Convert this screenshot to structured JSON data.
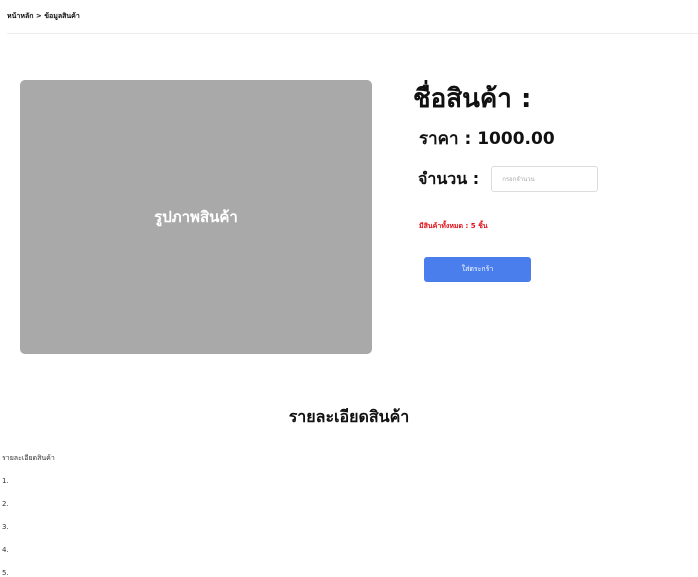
{
  "breadcrumb": {
    "text": "หน้าหลัก > ข้อมูลสินค้า"
  },
  "product": {
    "image_label": "รูปภาพสินค้า",
    "name": "ชื่อสินค้า :",
    "price_text": "ราคา : 1000.00",
    "quantity_label": "จำนวน :",
    "quantity_placeholder": "กรอกจำนวน",
    "stock_text": "มีสินค้าทั้งหมด : 5 ชิ้น",
    "add_to_cart_label": "ใส่ตระกร้า"
  },
  "details": {
    "heading": "รายละเอียดสินค้า",
    "intro": "รายละเอียดสินค้า",
    "items": [
      "1.",
      "2.",
      "3.",
      "4.",
      "5."
    ]
  },
  "colors": {
    "image_placeholder": "#a9a9a9",
    "button": "#4a7eec",
    "stock_text": "#e0111b"
  }
}
